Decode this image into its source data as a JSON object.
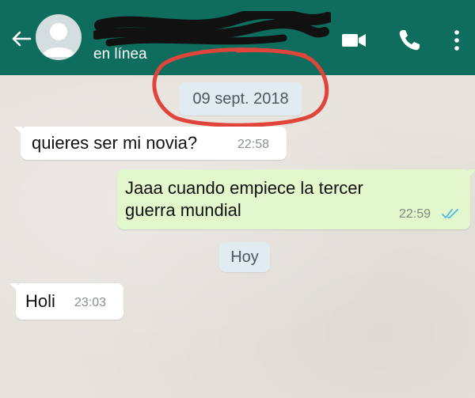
{
  "header": {
    "status": "en línea",
    "background_color": "#0f6d5d"
  },
  "icons": {
    "back": "arrow-left-icon",
    "avatar": "avatar-icon",
    "video": "video-camera-icon",
    "call": "phone-icon",
    "menu": "more-vertical-icon"
  },
  "chat": {
    "date_chips": [
      "09 sept. 2018",
      "Hoy"
    ],
    "messages": [
      {
        "direction": "in",
        "text": "quieres ser mi novia?",
        "time": "22:58"
      },
      {
        "direction": "out",
        "text": "Jaaa cuando empiece la tercer guerra mundial",
        "time": "22:59",
        "status": "read"
      },
      {
        "direction": "in",
        "text": "Holi",
        "time": "23:03"
      }
    ],
    "annotation_color": "#e0443a"
  }
}
